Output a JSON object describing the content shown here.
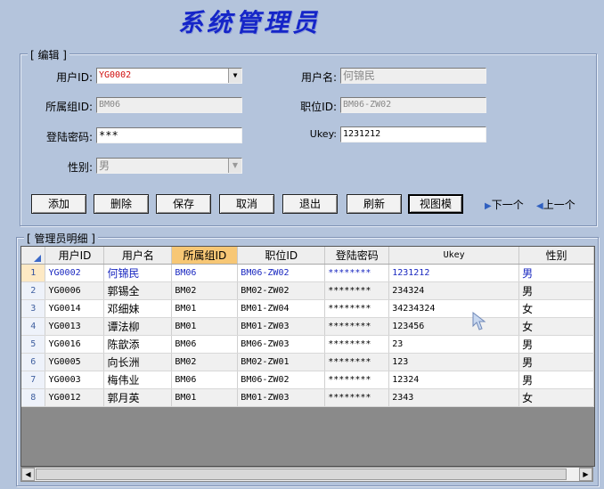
{
  "title": "系统管理员",
  "edit_group": {
    "title": "[ 编辑 ]",
    "user_id": {
      "label": "用户ID:",
      "value": "YG0002"
    },
    "user_name": {
      "label": "用户名:",
      "value": "何锦民"
    },
    "group_id": {
      "label": "所属组ID:",
      "value": "BM06"
    },
    "position_id": {
      "label": "职位ID:",
      "value": "BM06-ZW02"
    },
    "password": {
      "label": "登陆密码:",
      "value": "***"
    },
    "ukey": {
      "label": "Ukey:",
      "value": "1231212"
    },
    "gender": {
      "label": "性别:",
      "value": "男"
    }
  },
  "buttons": {
    "add": "添加",
    "delete": "删除",
    "save": "保存",
    "cancel": "取消",
    "exit": "退出",
    "refresh": "刷新",
    "view_mode": "视图模",
    "next": "下一个",
    "prev": "上一个"
  },
  "detail_group": {
    "title": "[ 管理员明细 ]"
  },
  "table": {
    "columns": [
      "用户ID",
      "用户名",
      "所属组ID",
      "职位ID",
      "登陆密码",
      "Ukey",
      "性别"
    ],
    "rows": [
      {
        "n": "1",
        "id": "YG0002",
        "name": "何锦民",
        "group": "BM06",
        "pos": "BM06-ZW02",
        "pwd": "********",
        "ukey": "1231212",
        "gender": "男"
      },
      {
        "n": "2",
        "id": "YG0006",
        "name": "郭锡全",
        "group": "BM02",
        "pos": "BM02-ZW02",
        "pwd": "********",
        "ukey": "234324",
        "gender": "男"
      },
      {
        "n": "3",
        "id": "YG0014",
        "name": "邓细妹",
        "group": "BM01",
        "pos": "BM01-ZW04",
        "pwd": "********",
        "ukey": "34234324",
        "gender": "女"
      },
      {
        "n": "4",
        "id": "YG0013",
        "name": "谭法柳",
        "group": "BM01",
        "pos": "BM01-ZW03",
        "pwd": "********",
        "ukey": "123456",
        "gender": "女"
      },
      {
        "n": "5",
        "id": "YG0016",
        "name": "陈歆添",
        "group": "BM06",
        "pos": "BM06-ZW03",
        "pwd": "********",
        "ukey": "23",
        "gender": "男"
      },
      {
        "n": "6",
        "id": "YG0005",
        "name": "向长洲",
        "group": "BM02",
        "pos": "BM02-ZW01",
        "pwd": "********",
        "ukey": "123",
        "gender": "男"
      },
      {
        "n": "7",
        "id": "YG0003",
        "name": "梅伟业",
        "group": "BM06",
        "pos": "BM06-ZW02",
        "pwd": "********",
        "ukey": "12324",
        "gender": "男"
      },
      {
        "n": "8",
        "id": "YG0012",
        "name": "郭月英",
        "group": "BM01",
        "pos": "BM01-ZW03",
        "pwd": "********",
        "ukey": "2343",
        "gender": "女"
      }
    ]
  },
  "colors": {
    "background": "#b4c4dc",
    "title": "#1525c8",
    "selected_header": "#f7c775",
    "selected_row_text": "#1a28c0"
  },
  "icons": [
    "dropdown-arrow-icon",
    "next-arrow-icon",
    "prev-arrow-icon",
    "scroll-left-icon",
    "scroll-right-icon",
    "mouse-cursor-icon"
  ]
}
